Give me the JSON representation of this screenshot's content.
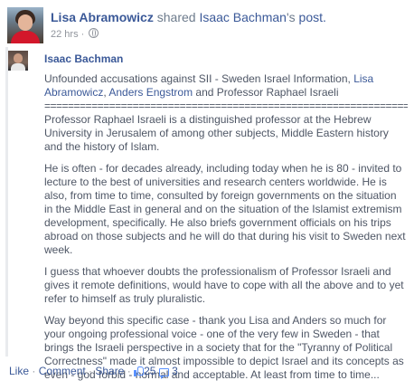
{
  "header": {
    "sharer_name": "Lisa Abramowicz",
    "shared_text": " shared ",
    "original_author_name": "Isaac Bachman",
    "original_author_suffix": "'s",
    "post_word": " post.",
    "time": "22 hrs",
    "privacy_icon": "globe-icon"
  },
  "shared_post": {
    "author": "Isaac Bachman",
    "intro": "Unfounded accusations against SII - Sweden Israel Information, ",
    "tag1": "Lisa Abramowicz",
    "comma": ",",
    "tag2": "Anders Engstrom",
    "intro_end": " and Professor Raphael Israeli",
    "divider": "================================================================",
    "paragraphs": [
      "Professor Raphael Israeli is a distinguished professor at the Hebrew University in Jerusalem of among other subjects, Middle Eastern history and the history of Islam.",
      "He is often - for decades already, including today when he is 80 - invited to lecture to the best of universities and research centers worldwide. He is also, from time to time, consulted by foreign governments on the situation in the Middle East in general and on the situation of the Islamist extremism development, specifically. He also briefs government officials on his trips abroad on those subjects and he will do that during his visit to Sweden next week.",
      "I guess that whoever doubts the professionalism of Professor Israeli and gives it remote definitions, would have to cope with all the above and to yet refer to himself as truly pluralistic.",
      "Way beyond this specific case - thank you Lisa and Anders so much for your ongoing professional voice - one of the very few in Sweden - that brings the Israeli perspective in a society that for the \"Tyranny of Political Correctness\" made it almost impossible to depict Israel and its concepts as even - god forbid - normal and acceptable. At least from time to time..."
    ]
  },
  "actions": {
    "like": "Like",
    "comment": "Comment",
    "share": "Share",
    "sep": " · ",
    "like_count": "25",
    "comment_count": "3"
  }
}
